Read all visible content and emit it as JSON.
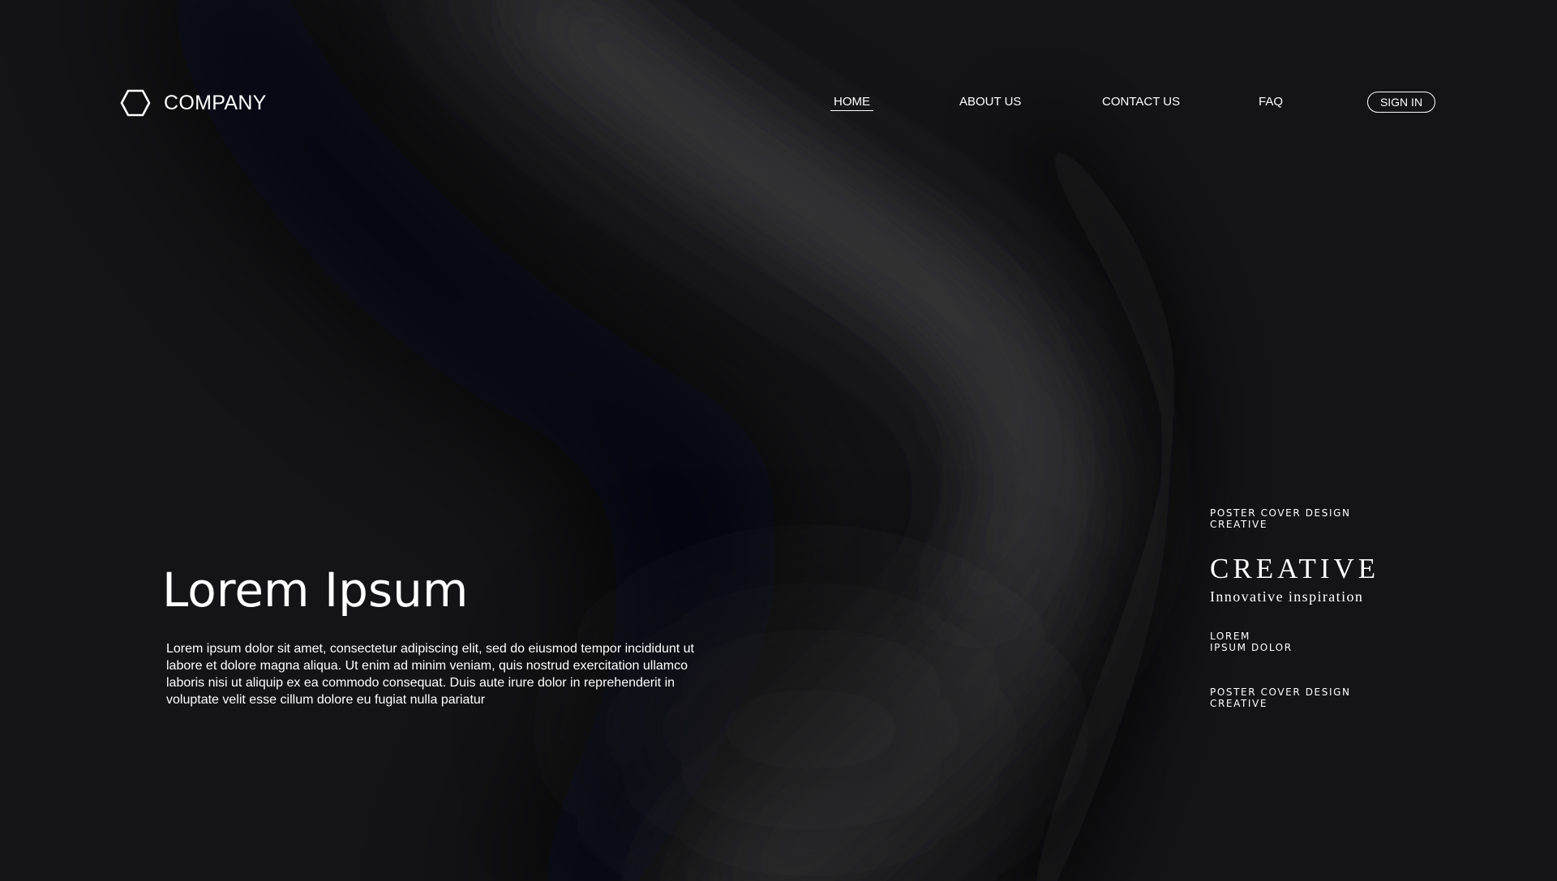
{
  "brand": {
    "name": "COMPANY",
    "logo_icon": "hexagon-icon"
  },
  "nav": {
    "items": [
      {
        "label": "HOME",
        "active": true
      },
      {
        "label": "ABOUT US",
        "active": false
      },
      {
        "label": "CONTACT US",
        "active": false
      },
      {
        "label": "FAQ",
        "active": false
      }
    ],
    "sign_in_label": "SIGN IN"
  },
  "hero": {
    "title": "Lorem Ipsum",
    "body_lines": [
      "Lorem ipsum dolor sit amet, consectetur adipiscing elit, sed do eiusmod tempor incididunt ut",
      "labore et dolore magna aliqua. Ut enim ad minim veniam, quis nostrud exercitation ullamco",
      "laboris nisi ut aliquip ex ea commodo consequat. Duis aute irure dolor in reprehenderit in",
      "voluptate velit esse cillum dolore eu fugiat nulla pariatur"
    ]
  },
  "side": {
    "block1": {
      "line1": "POSTER COVER DESIGN",
      "line2": "CREATIVE"
    },
    "headline": "CREATIVE",
    "tagline": "Innovative inspiration",
    "block2": {
      "line1": "LOREM",
      "line2": "IPSUM DOLOR"
    },
    "block3": {
      "line1": "POSTER COVER DESIGN",
      "line2": "CREATIVE"
    }
  },
  "colors": {
    "background": "#141416",
    "highlight": "#3a3a3c",
    "text": "#ffffff"
  }
}
